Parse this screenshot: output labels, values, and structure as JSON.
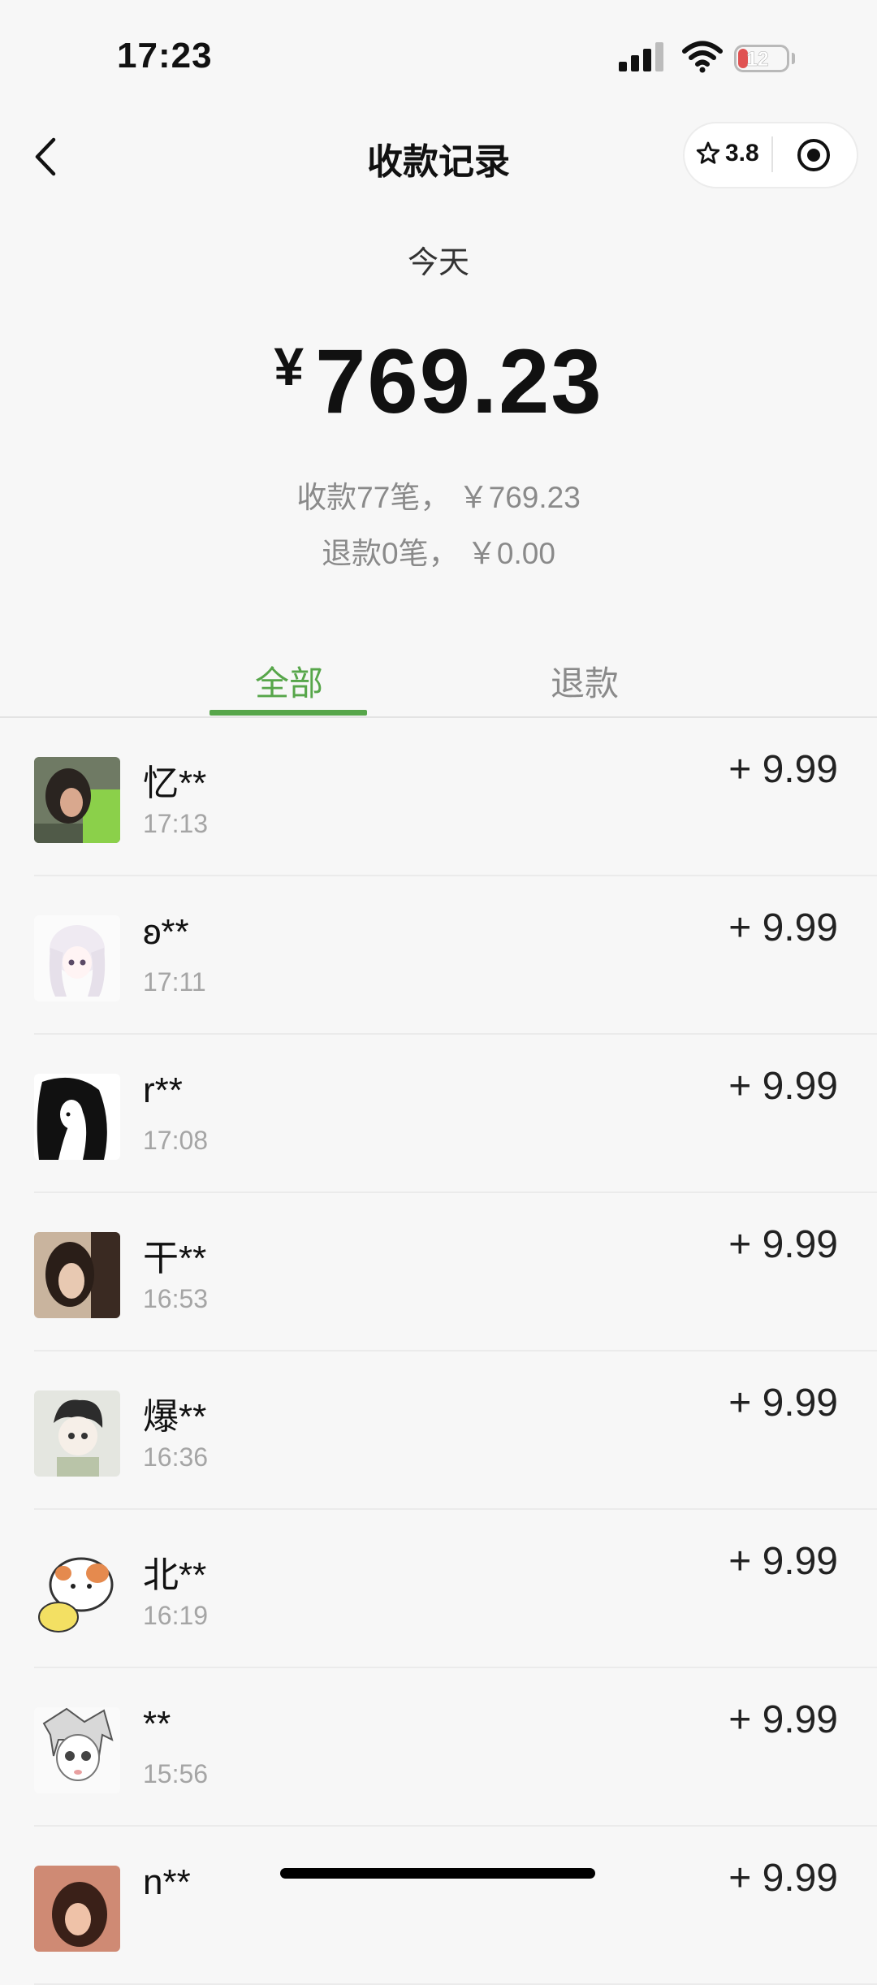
{
  "status_bar": {
    "time": "17:23",
    "battery": "12"
  },
  "nav": {
    "title": "收款记录",
    "rating": "3.8"
  },
  "summary": {
    "period": "今天",
    "currency": "¥",
    "total_amount": "769.23",
    "income_line": "收款77笔， ￥769.23",
    "refund_line": "退款0笔， ￥0.00"
  },
  "tabs": [
    {
      "label": "全部",
      "active": true
    },
    {
      "label": "退款",
      "active": false
    }
  ],
  "records": [
    {
      "name": "忆**",
      "time": "17:13",
      "amount": "+ 9.99"
    },
    {
      "name": "ʚ**",
      "time": "17:11",
      "amount": "+ 9.99"
    },
    {
      "name": "r**",
      "time": "17:08",
      "amount": "+ 9.99"
    },
    {
      "name": "干**",
      "time": "16:53",
      "amount": "+ 9.99"
    },
    {
      "name": "爆**",
      "time": "16:36",
      "amount": "+ 9.99"
    },
    {
      "name": "北**",
      "time": "16:19",
      "amount": "+ 9.99"
    },
    {
      "name": " **",
      "time": "15:56",
      "amount": "+ 9.99"
    },
    {
      "name": "n**",
      "time": "",
      "amount": "+ 9.99"
    }
  ],
  "colors": {
    "accent": "#57a64a",
    "background": "#f7f7f7",
    "muted_text": "#a5a5a5"
  }
}
